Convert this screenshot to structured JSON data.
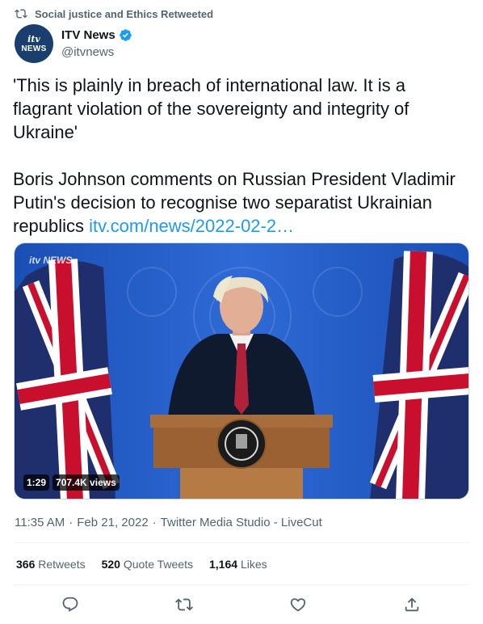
{
  "social_context": {
    "text": "Social justice and Ethics Retweeted",
    "icon": "retweet-icon"
  },
  "author": {
    "display_name": "ITV News",
    "handle": "@itvnews",
    "verified": true,
    "avatar_logo_top": "itv",
    "avatar_logo_bottom": "NEWS",
    "verified_color": "#1d9bf0",
    "avatar_color": "#1a3f6e"
  },
  "tweet": {
    "quote": "'This is plainly in breach of international law. It is a flagrant violation of the sovereignty and integrity of Ukraine'",
    "body": "Boris Johnson comments on Russian President Vladimir Putin's decision to recognise two separatist Ukrainian republics",
    "link_text": "itv.com/news/2022-02-2…",
    "link_color": "#1d9bf0"
  },
  "media": {
    "watermark": "itv NEWS",
    "duration": "1:29",
    "views": "707.4K views"
  },
  "meta": {
    "time": "11:35 AM",
    "separator": "·",
    "date": "Feb 21, 2022",
    "source": "Twitter Media Studio - LiveCut"
  },
  "stats": [
    {
      "count": "366",
      "label": "Retweets"
    },
    {
      "count": "520",
      "label": "Quote Tweets"
    },
    {
      "count": "1,164",
      "label": "Likes"
    }
  ],
  "actions": [
    "reply-icon",
    "retweet-icon",
    "like-icon",
    "share-icon"
  ]
}
